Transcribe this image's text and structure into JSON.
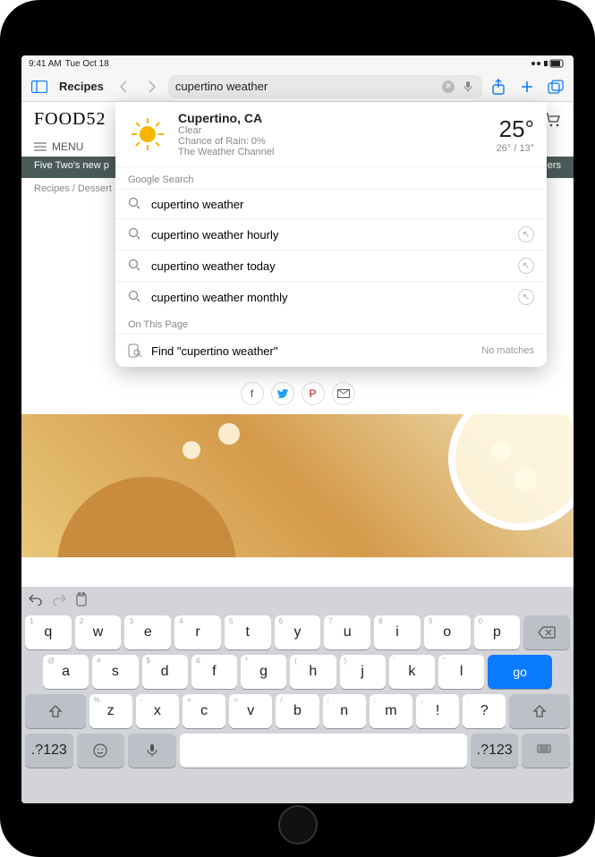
{
  "status": {
    "time": "9:41 AM",
    "date": "Tue Oct 18"
  },
  "toolbar": {
    "tab_label": "Recipes",
    "address_value": "cupertino weather"
  },
  "site": {
    "logo": "FOOD52",
    "menu_label": "MENU",
    "promo_left": "Five Two's new p",
    "promo_right": "Orders",
    "breadcrumb": "Recipes / Dessert"
  },
  "weather": {
    "location": "Cupertino, CA",
    "condition": "Clear",
    "rain": "Chance of Rain: 0%",
    "source": "The Weather Channel",
    "temp": "25°",
    "hilo": "26° / 13°"
  },
  "suggestions": {
    "section1": "Google Search",
    "items": [
      "cupertino weather",
      "cupertino weather hourly",
      "cupertino weather today",
      "cupertino weather monthly"
    ],
    "section2": "On This Page",
    "find_label": "Find \"cupertino weather\"",
    "find_matches": "No matches"
  },
  "keyboard": {
    "row1": [
      {
        "k": "q",
        "s": "1"
      },
      {
        "k": "w",
        "s": "2"
      },
      {
        "k": "e",
        "s": "3"
      },
      {
        "k": "r",
        "s": "4"
      },
      {
        "k": "t",
        "s": "5"
      },
      {
        "k": "y",
        "s": "6"
      },
      {
        "k": "u",
        "s": "7"
      },
      {
        "k": "i",
        "s": "8"
      },
      {
        "k": "o",
        "s": "9"
      },
      {
        "k": "p",
        "s": "0"
      }
    ],
    "row2": [
      {
        "k": "a",
        "s": "@"
      },
      {
        "k": "s",
        "s": "#"
      },
      {
        "k": "d",
        "s": "$"
      },
      {
        "k": "f",
        "s": "&"
      },
      {
        "k": "g",
        "s": "*"
      },
      {
        "k": "h",
        "s": "("
      },
      {
        "k": "j",
        "s": ")"
      },
      {
        "k": "k",
        "s": "'"
      },
      {
        "k": "l",
        "s": "\""
      }
    ],
    "row3": [
      {
        "k": "z",
        "s": "%"
      },
      {
        "k": "x",
        "s": "-"
      },
      {
        "k": "c",
        "s": "+"
      },
      {
        "k": "v",
        "s": "="
      },
      {
        "k": "b",
        "s": "/"
      },
      {
        "k": "n",
        "s": ";"
      },
      {
        "k": "m",
        "s": ":"
      },
      {
        "k": "!",
        "s": ","
      },
      {
        "k": "?",
        "s": "."
      }
    ],
    "numkey": ".?123",
    "go": "go"
  }
}
